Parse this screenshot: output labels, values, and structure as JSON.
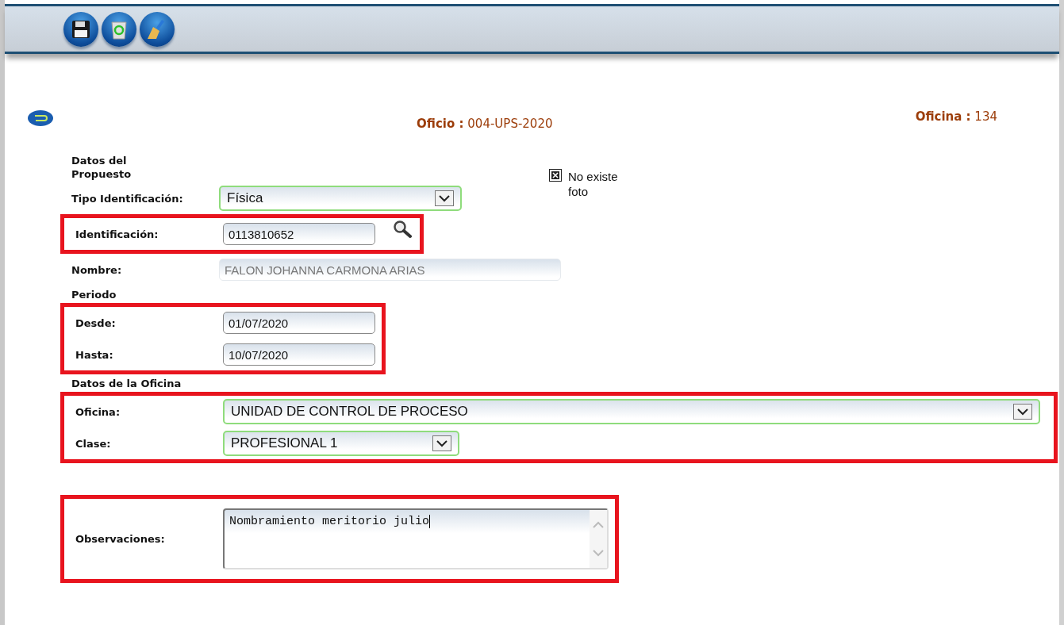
{
  "toolbar": {
    "buttons": [
      {
        "kind": "save"
      },
      {
        "kind": "recycle"
      },
      {
        "kind": "clean"
      }
    ]
  },
  "header": {
    "oficio_label": "Oficio :",
    "oficio_value": "004-UPS-2020",
    "oficina_label": "Oficina :",
    "oficina_value": "134"
  },
  "photo": {
    "text": "No existe foto"
  },
  "form": [
    {
      "kind": "heading",
      "text": "Datos del Propuesto"
    },
    {
      "kind": "row",
      "row": {
        "label": "Tipo Identificación:",
        "kind": "select",
        "value": "Física"
      }
    },
    {
      "kind": "group",
      "highlighted": true,
      "rows": [
        {
          "label": "Identificación:",
          "kind": "input",
          "value": "0113810652",
          "search": true
        }
      ]
    },
    {
      "kind": "row",
      "row": {
        "label": "Nombre:",
        "kind": "readonly",
        "value": "FALON JOHANNA CARMONA ARIAS"
      }
    },
    {
      "kind": "heading",
      "text": "Periodo"
    },
    {
      "kind": "group",
      "highlighted": true,
      "rows": [
        {
          "label": "Desde:",
          "kind": "input",
          "value": "01/07/2020"
        },
        {
          "label": "Hasta:",
          "kind": "input",
          "value": "10/07/2020"
        }
      ]
    },
    {
      "kind": "heading",
      "text": "Datos de la Oficina"
    },
    {
      "kind": "group",
      "highlighted": true,
      "wide": true,
      "rows": [
        {
          "label": "Oficina:",
          "kind": "select",
          "value": "UNIDAD DE CONTROL DE PROCESO",
          "wide": true
        },
        {
          "label": "Clase:",
          "kind": "select",
          "value": "PROFESIONAL 1"
        }
      ]
    },
    {
      "kind": "group",
      "highlighted": true,
      "rows": [
        {
          "label": "Observaciones:",
          "kind": "textarea",
          "value": "Nombramiento meritorio julio"
        }
      ]
    }
  ]
}
